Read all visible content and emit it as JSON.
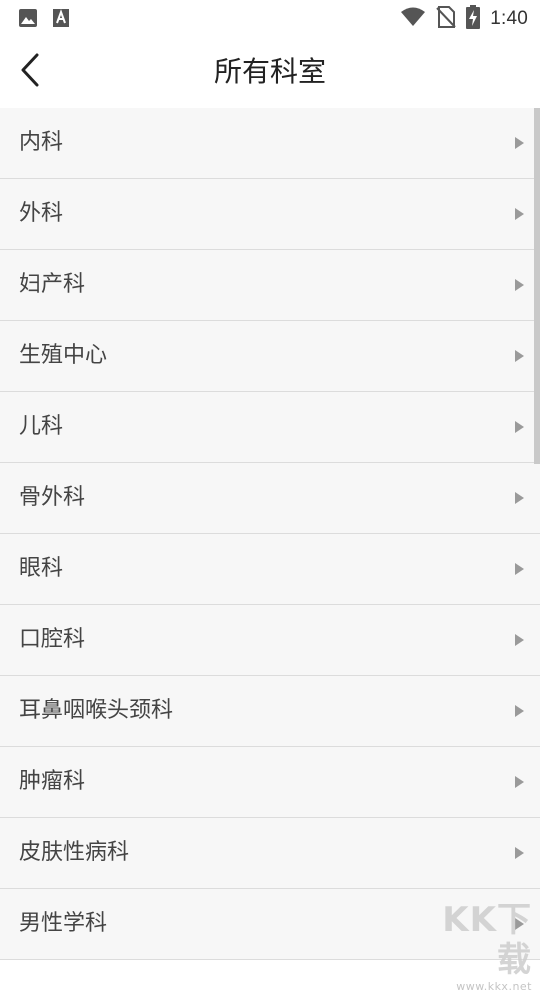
{
  "status_bar": {
    "time": "1:40",
    "icons": [
      "image-icon",
      "text-a-icon",
      "wifi-icon",
      "no-sim-icon",
      "battery-charging-icon"
    ]
  },
  "toolbar": {
    "title": "所有科室",
    "back_icon": "chevron-left-icon"
  },
  "departments": [
    {
      "label": "内科"
    },
    {
      "label": "外科"
    },
    {
      "label": "妇产科"
    },
    {
      "label": "生殖中心"
    },
    {
      "label": "儿科"
    },
    {
      "label": "骨外科"
    },
    {
      "label": "眼科"
    },
    {
      "label": "口腔科"
    },
    {
      "label": "耳鼻咽喉头颈科"
    },
    {
      "label": "肿瘤科"
    },
    {
      "label": "皮肤性病科"
    },
    {
      "label": "男性学科"
    }
  ],
  "watermark": {
    "brand": "KK下载",
    "url": "www.kkx.net"
  },
  "colors": {
    "list_background": "#f7f7f7",
    "divider": "#dcdcdc",
    "text": "#444444",
    "arrow": "#9a9a9a"
  }
}
